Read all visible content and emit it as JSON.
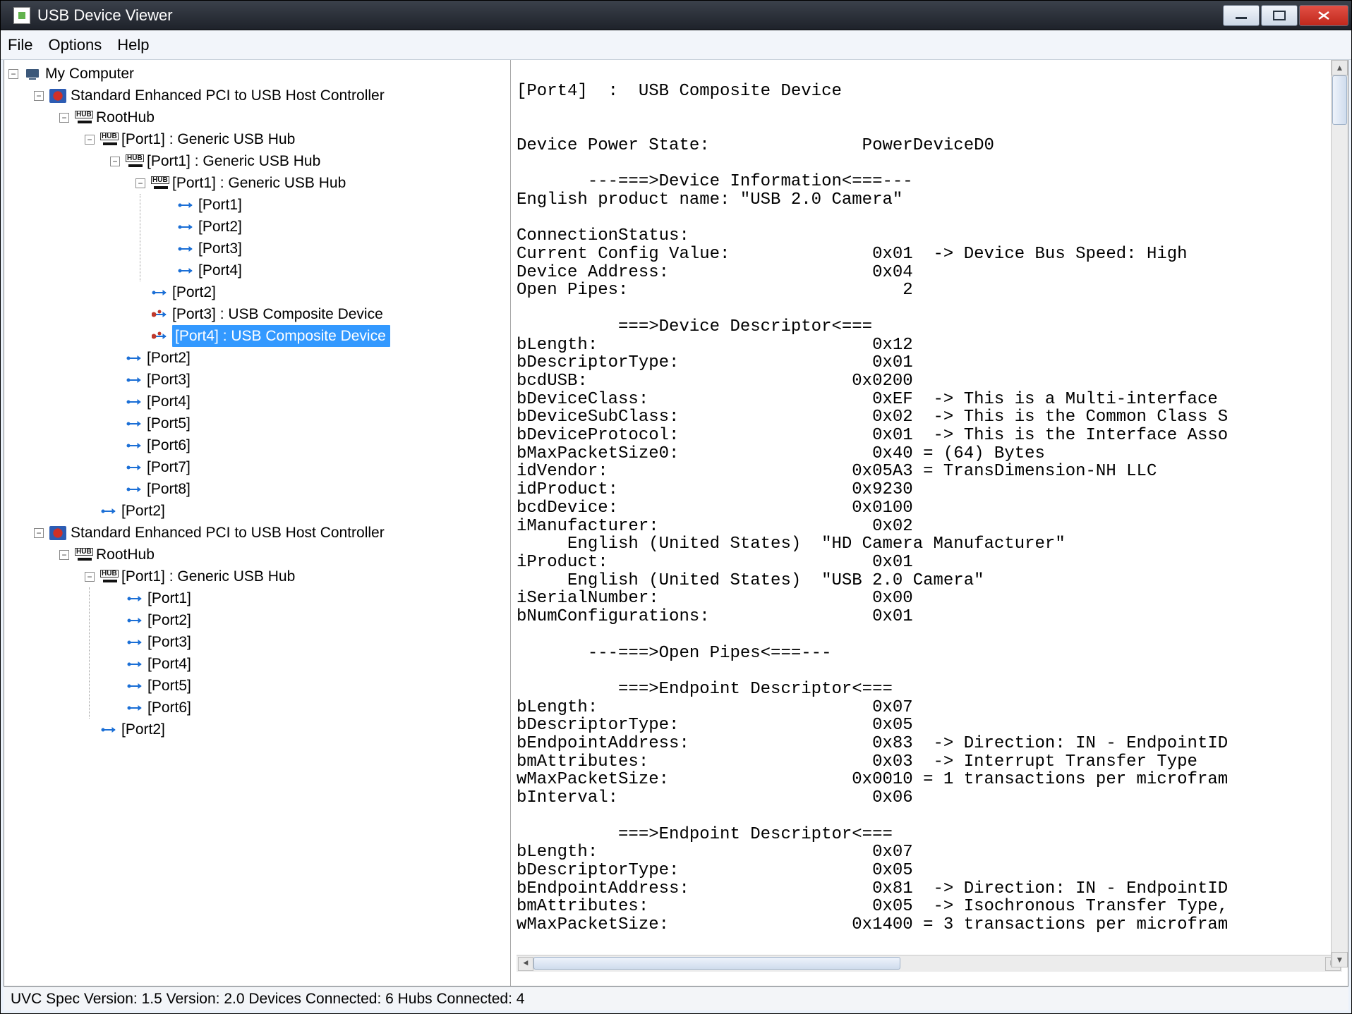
{
  "window": {
    "title": "USB Device Viewer"
  },
  "menu": {
    "file": "File",
    "options": "Options",
    "help": "Help"
  },
  "tree": {
    "root": "My Computer",
    "host1": "Standard Enhanced PCI to USB Host Controller",
    "roothub": "RootHub",
    "p1hub": "[Port1] :  Generic USB Hub",
    "p1hub2": "[Port1] :  Generic USB Hub",
    "p1hub3": "[Port1] :  Generic USB Hub",
    "port1": "[Port1]",
    "port2": "[Port2]",
    "port3": "[Port3]",
    "port4": "[Port4]",
    "p3comp": "[Port3] :  USB Composite Device",
    "p4comp": "[Port4] :  USB Composite Device",
    "port5": "[Port5]",
    "port6": "[Port6]",
    "port7": "[Port7]",
    "port8": "[Port8]",
    "host2": "Standard Enhanced PCI to USB Host Controller"
  },
  "detail": {
    "text": "[Port4]  :  USB Composite Device\n\n\nDevice Power State:               PowerDeviceD0\n\n       ---===>Device Information<===---\nEnglish product name: \"USB 2.0 Camera\"\n\nConnectionStatus:\nCurrent Config Value:              0x01  -> Device Bus Speed: High\nDevice Address:                    0x04\nOpen Pipes:                           2\n\n          ===>Device Descriptor<===\nbLength:                           0x12\nbDescriptorType:                   0x01\nbcdUSB:                          0x0200\nbDeviceClass:                      0xEF  -> This is a Multi-interface \nbDeviceSubClass:                   0x02  -> This is the Common Class S\nbDeviceProtocol:                   0x01  -> This is the Interface Asso\nbMaxPacketSize0:                   0x40 = (64) Bytes\nidVendor:                        0x05A3 = TransDimension-NH LLC\nidProduct:                       0x9230\nbcdDevice:                       0x0100\niManufacturer:                     0x02\n     English (United States)  \"HD Camera Manufacturer\"\niProduct:                          0x01\n     English (United States)  \"USB 2.0 Camera\"\niSerialNumber:                     0x00\nbNumConfigurations:                0x01\n\n       ---===>Open Pipes<===---\n\n          ===>Endpoint Descriptor<===\nbLength:                           0x07\nbDescriptorType:                   0x05\nbEndpointAddress:                  0x83  -> Direction: IN - EndpointID\nbmAttributes:                      0x03  -> Interrupt Transfer Type\nwMaxPacketSize:                  0x0010 = 1 transactions per microfram\nbInterval:                         0x06\n\n          ===>Endpoint Descriptor<===\nbLength:                           0x07\nbDescriptorType:                   0x05\nbEndpointAddress:                  0x81  -> Direction: IN - EndpointID\nbmAttributes:                      0x05  -> Isochronous Transfer Type,\nwMaxPacketSize:                  0x1400 = 3 transactions per microfram"
  },
  "status": {
    "text": "UVC Spec Version: 1.5 Version: 2.0 Devices Connected: 6   Hubs Connected: 4"
  },
  "exp": {
    "minus": "−",
    "plus": "+"
  }
}
